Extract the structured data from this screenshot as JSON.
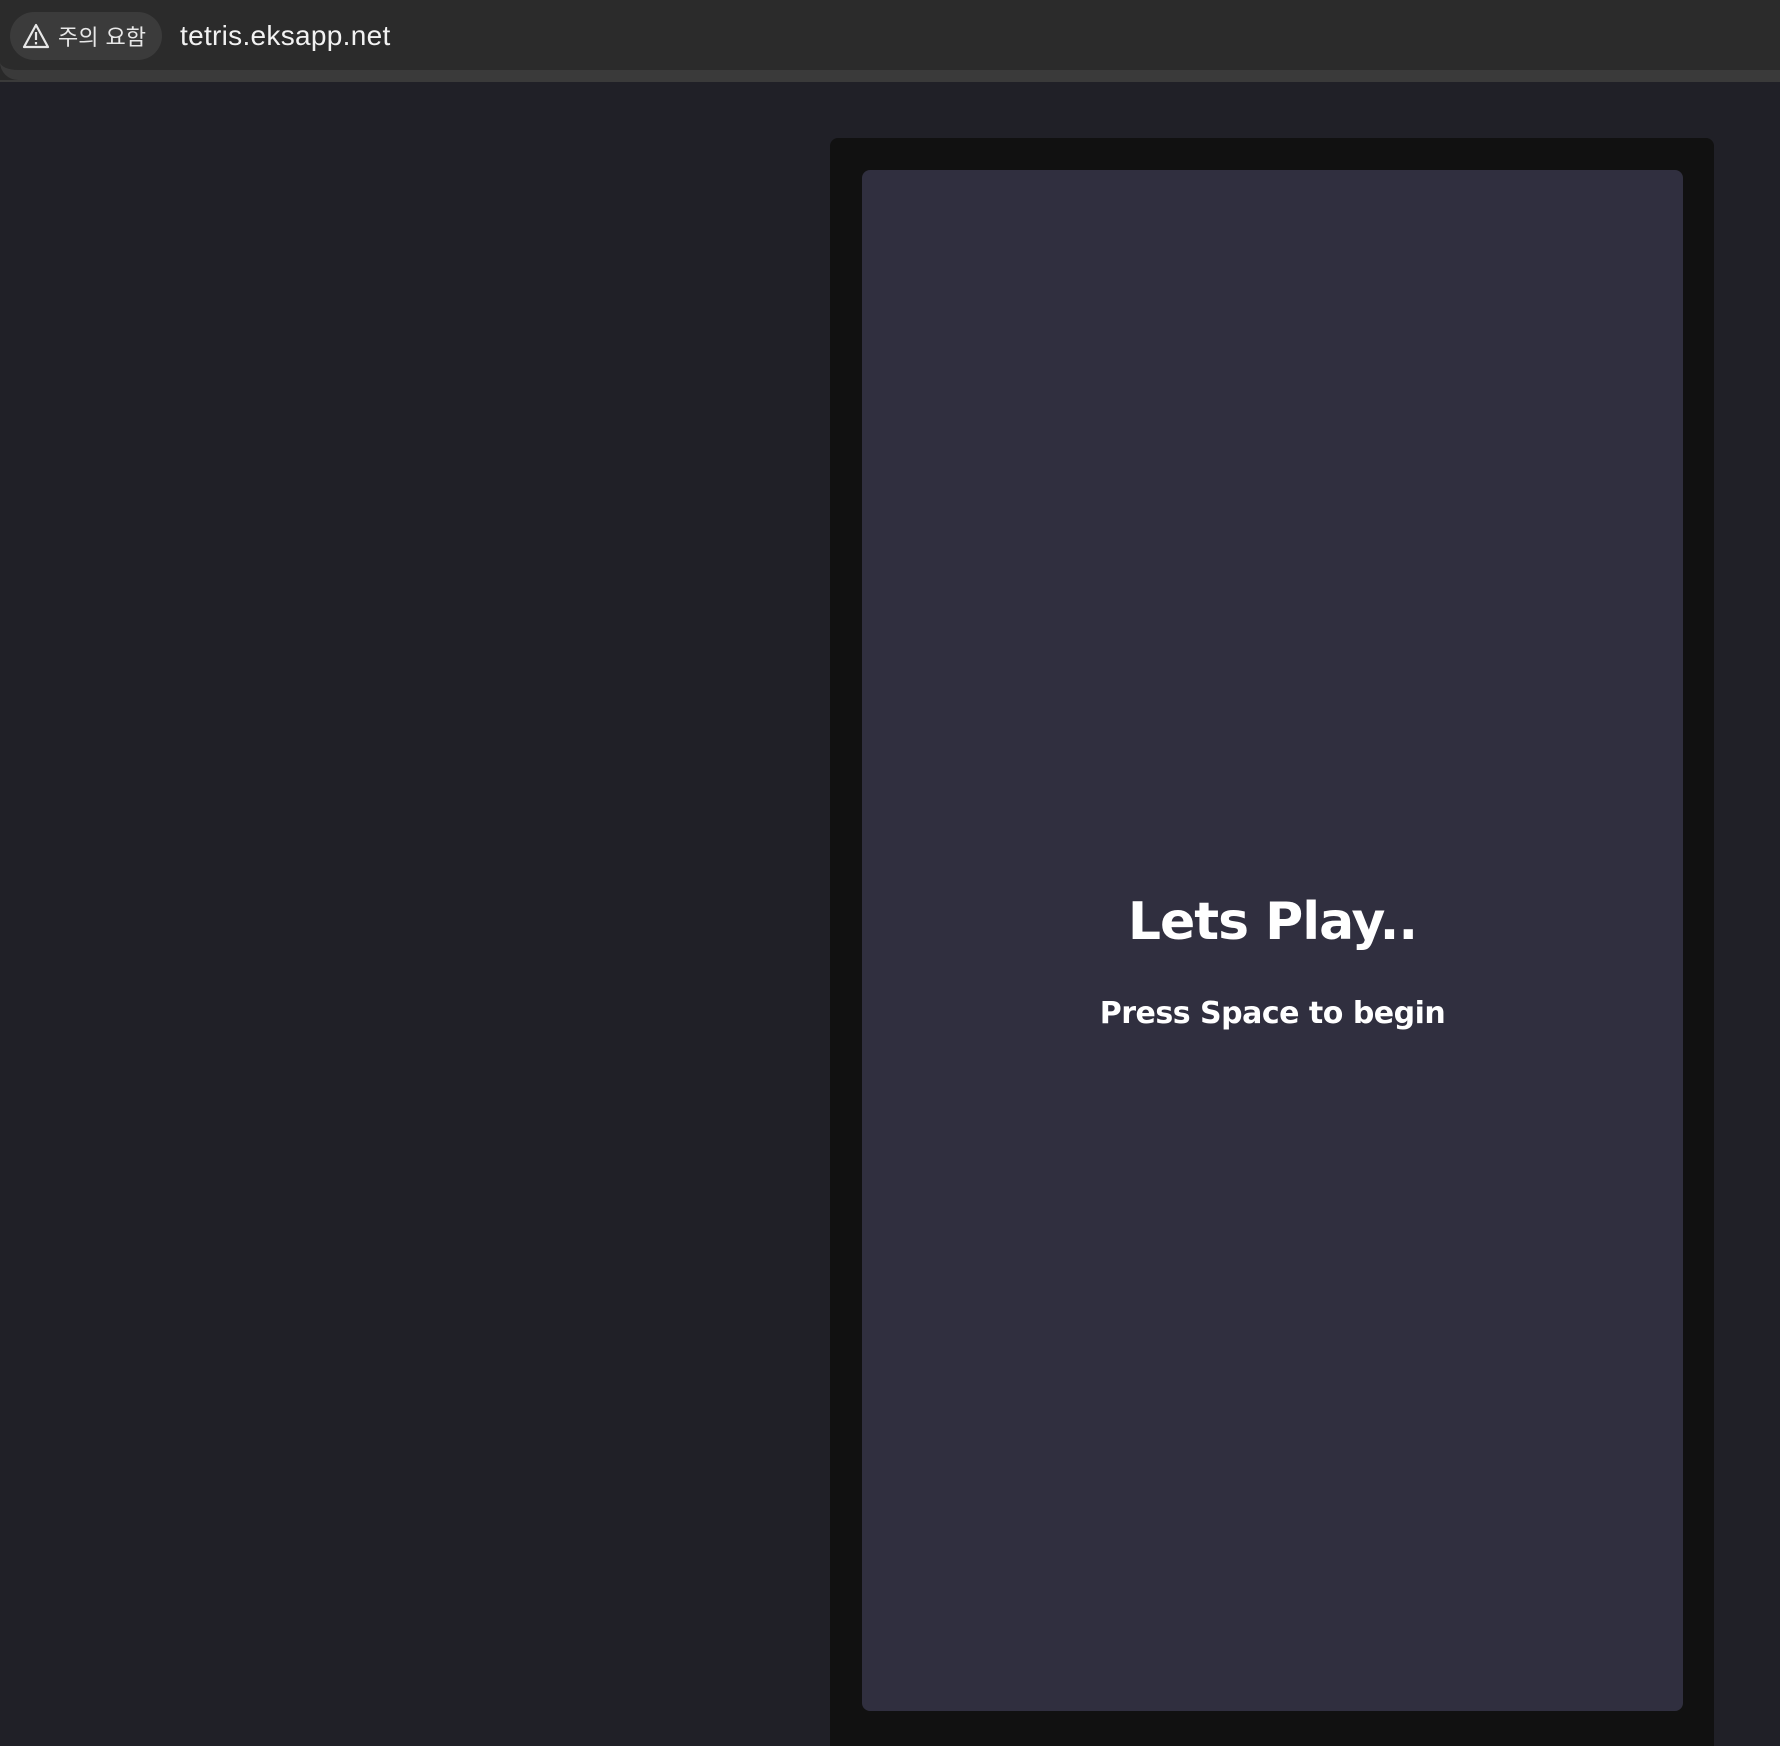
{
  "browser": {
    "security_label": "주의 요함",
    "url": "tetris.eksapp.net"
  },
  "game": {
    "title": "Lets Play..",
    "hint": "Press Space to begin",
    "colors": {
      "page_background": "#202027",
      "frame": "#111111",
      "board": "#302f3f",
      "text": "#ffffff"
    }
  }
}
